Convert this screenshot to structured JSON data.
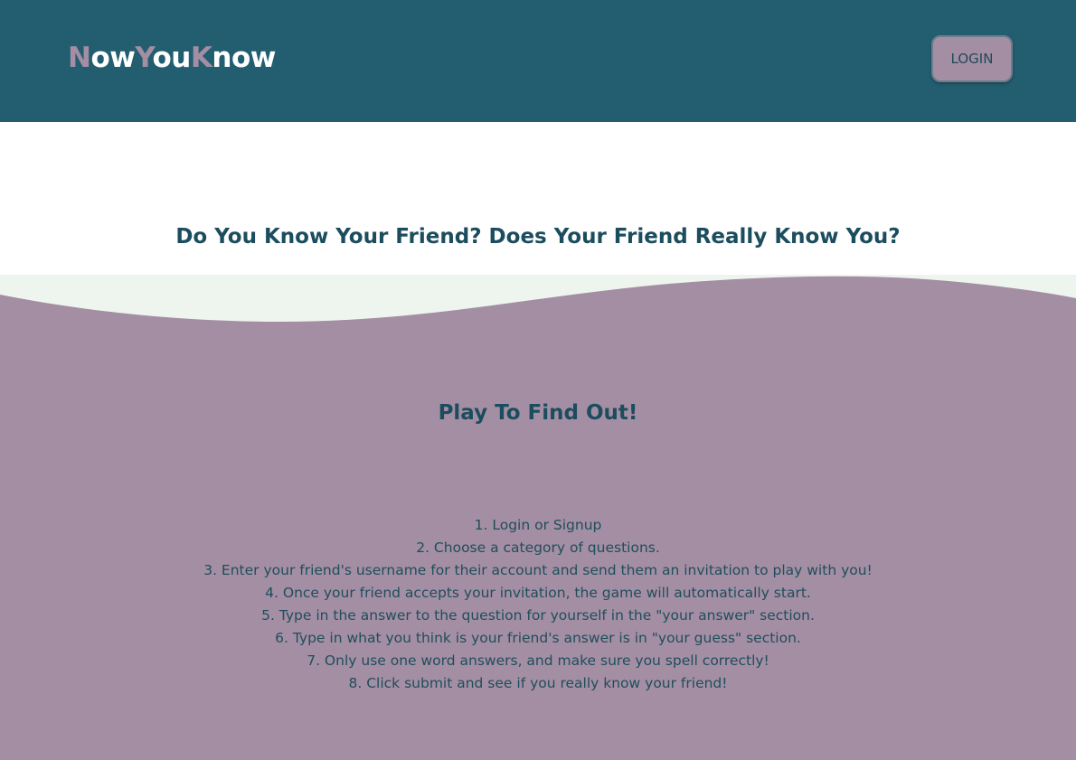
{
  "header": {
    "logo_parts": [
      "N",
      "ow",
      "Y",
      "ou",
      "K",
      "now"
    ],
    "login_label": "LOGIN"
  },
  "hero": {
    "title": "Do You Know Your Friend? Does Your Friend Really Know You?"
  },
  "instructions": {
    "title": "Play To Find Out!",
    "steps": [
      "1. Login or Signup",
      "2. Choose a category of questions.",
      "3. Enter your friend's username for their account and send them an invitation to play with you!",
      "4. Once your friend accepts your invitation, the game will automatically start.",
      "5. Type in the answer to the question for yourself in the \"your answer\" section.",
      "6. Type in what you think is your friend's answer is in \"your guess\" section.",
      "7. Only use one word answers, and make sure you spell correctly!",
      "8. Click submit and see if you really know your friend!"
    ]
  },
  "colors": {
    "header_bg": "#225e70",
    "accent": "#a48ea3",
    "wave_bg": "#eef5ee",
    "heading_text": "#1c4d5e"
  }
}
